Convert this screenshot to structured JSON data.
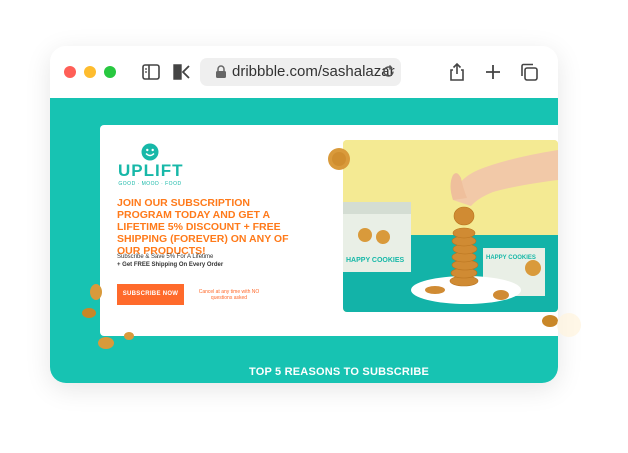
{
  "browser": {
    "url": "dribbble.com/sashalazar",
    "controls": [
      "close",
      "minimize",
      "maximize"
    ],
    "icons": [
      "sidebar-icon",
      "back-icon",
      "lock-icon",
      "reload-icon",
      "share-icon",
      "new-tab-icon",
      "tabs-icon"
    ]
  },
  "colors": {
    "page_bg": "#17c3b2",
    "accent": "#ff6a2b",
    "brand": "#17b8a8"
  },
  "hero": {
    "logo_brand": "UPLIFT",
    "logo_tagline": "GOOD · MOOD · FOOD",
    "headline": "JOIN OUR SUBSCRIPTION PROGRAM TODAY AND GET A LIFETIME 5% DISCOUNT + FREE SHIPPING (FOREVER) ON ANY OF OUR PRODUCTS!",
    "subtext_line1": "Subscribe & Save 5% For A Lifetime",
    "subtext_line2": "+ Get FREE Shipping On Every Order",
    "cta_label": "SUBSCRIBE NOW",
    "cancel_note": "Cancel at any time with NO questions asked",
    "product_label": "HAPPY COOKIES"
  },
  "section": {
    "title": "TOP 5 REASONS TO SUBSCRIBE"
  }
}
